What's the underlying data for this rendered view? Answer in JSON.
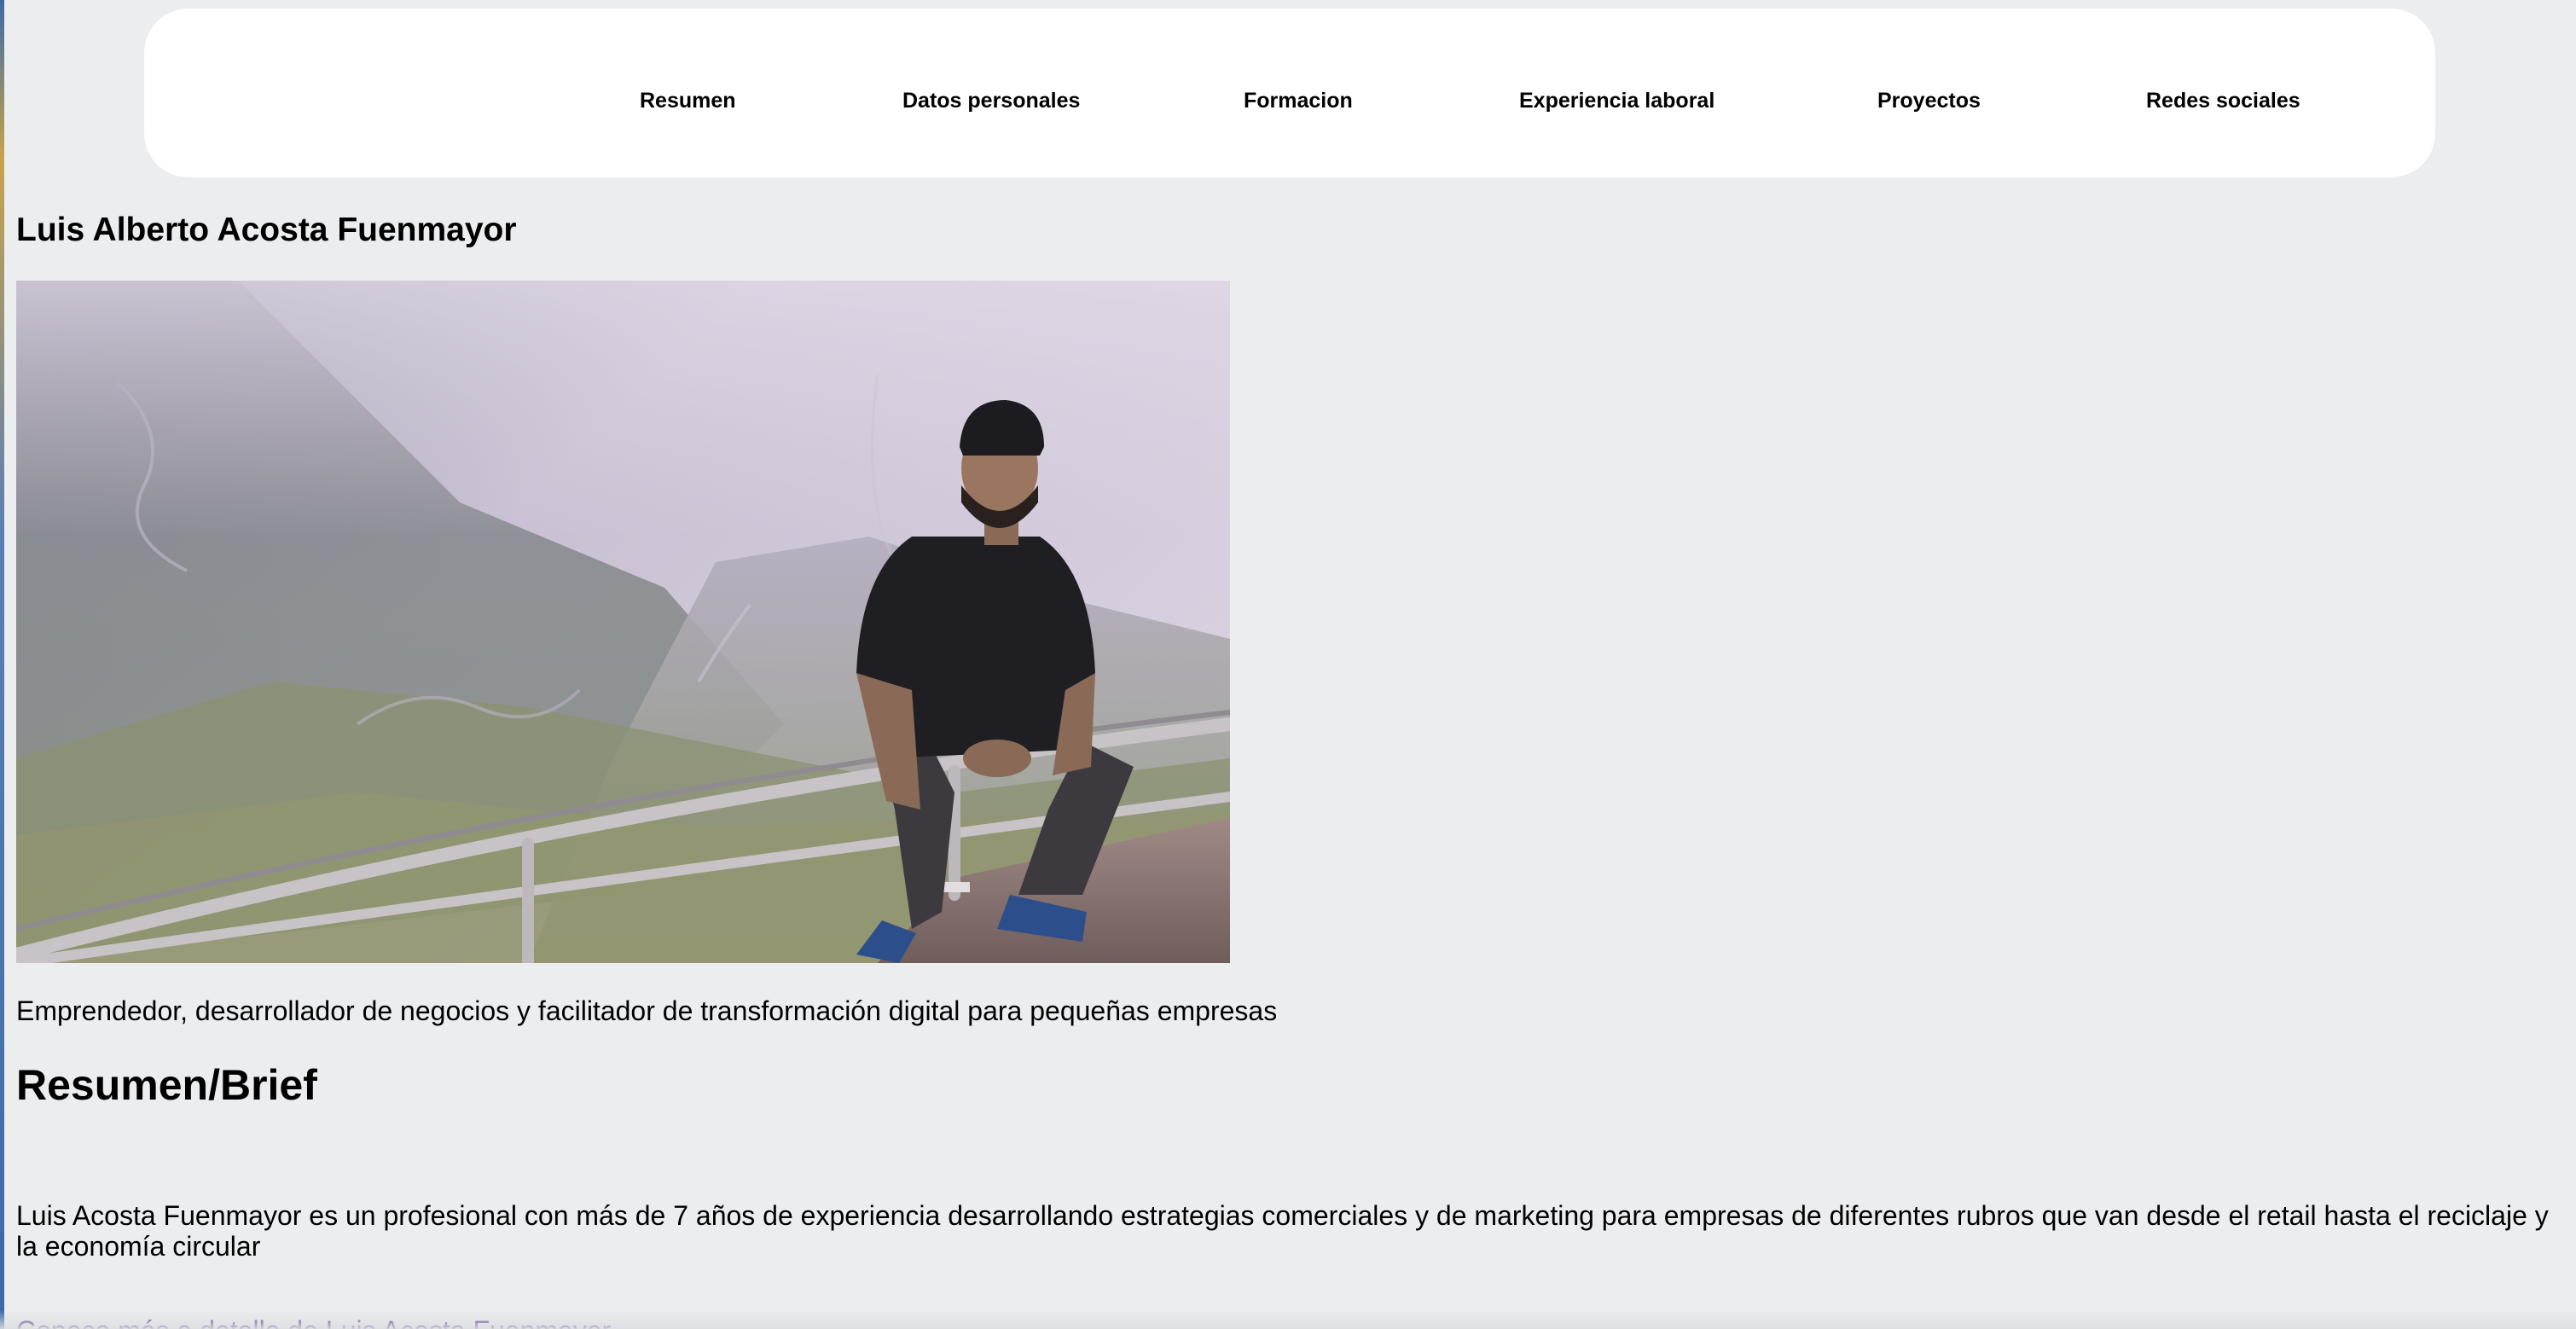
{
  "nav": {
    "items": [
      {
        "label": "Resumen"
      },
      {
        "label": "Datos personales"
      },
      {
        "label": "Formacion"
      },
      {
        "label": "Experiencia laboral"
      },
      {
        "label": "Proyectos"
      },
      {
        "label": "Redes sociales"
      }
    ]
  },
  "profile": {
    "name": "Luis Alberto Acosta Fuenmayor",
    "tagline": "Emprendedor, desarrollador de negocios y facilitador de transformación digital para pequeñas empresas"
  },
  "resumen": {
    "heading": "Resumen/Brief",
    "text": "Luis Acosta Fuenmayor es un profesional con más de 7 años de experiencia desarrollando estrategias comerciales y de marketing para empresas de diferentes rubros que van desde el retail hasta el reciclaje y la economía circular",
    "link_label": "Conoce más a detalle de Luis Acosta Fuenmayor"
  },
  "colors": {
    "page_background": "#ecedef",
    "nav_background": "#ffffff",
    "link": "#4b2a8a"
  }
}
